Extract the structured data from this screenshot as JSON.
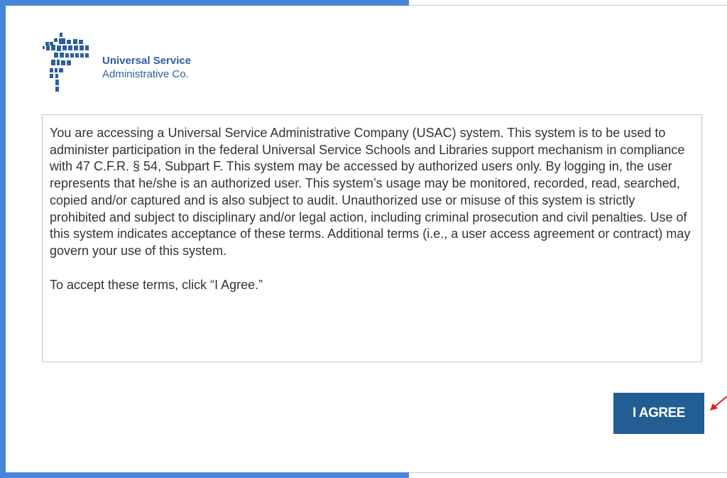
{
  "logo": {
    "line1": "Universal Service",
    "line2": "Administrative Co.",
    "color": "#2d5f9c"
  },
  "terms": {
    "body": "You are accessing a Universal Service Administrative Company (USAC) system.  This system is to be used to administer participation in the federal Universal Service Schools and Libraries support mechanism in compliance with 47 C.F.R. § 54, Subpart F.  This system may be accessed by authorized users only.  By logging in, the user represents that he/she is an authorized user.  This system’s usage may be monitored, recorded, read, searched, copied and/or captured and is also subject to audit.  Unauthorized use or misuse of this system is strictly prohibited and subject to disciplinary and/or legal action, including criminal prosecution and civil penalties.  Use of this system indicates acceptance of these terms.  Additional terms (i.e., a user access agreement or contract) may govern your use of this system.",
    "accept_instruction": "To accept these terms, click “I Agree.”"
  },
  "agree_button": {
    "label": "I AGREE",
    "color": "#225e93"
  },
  "colors": {
    "frame_border": "#4a86d8",
    "annotation_arrow": "#e0201b"
  },
  "icons": {
    "logo": "usac-logo-icon",
    "annotation": "red-arrow-icon"
  }
}
